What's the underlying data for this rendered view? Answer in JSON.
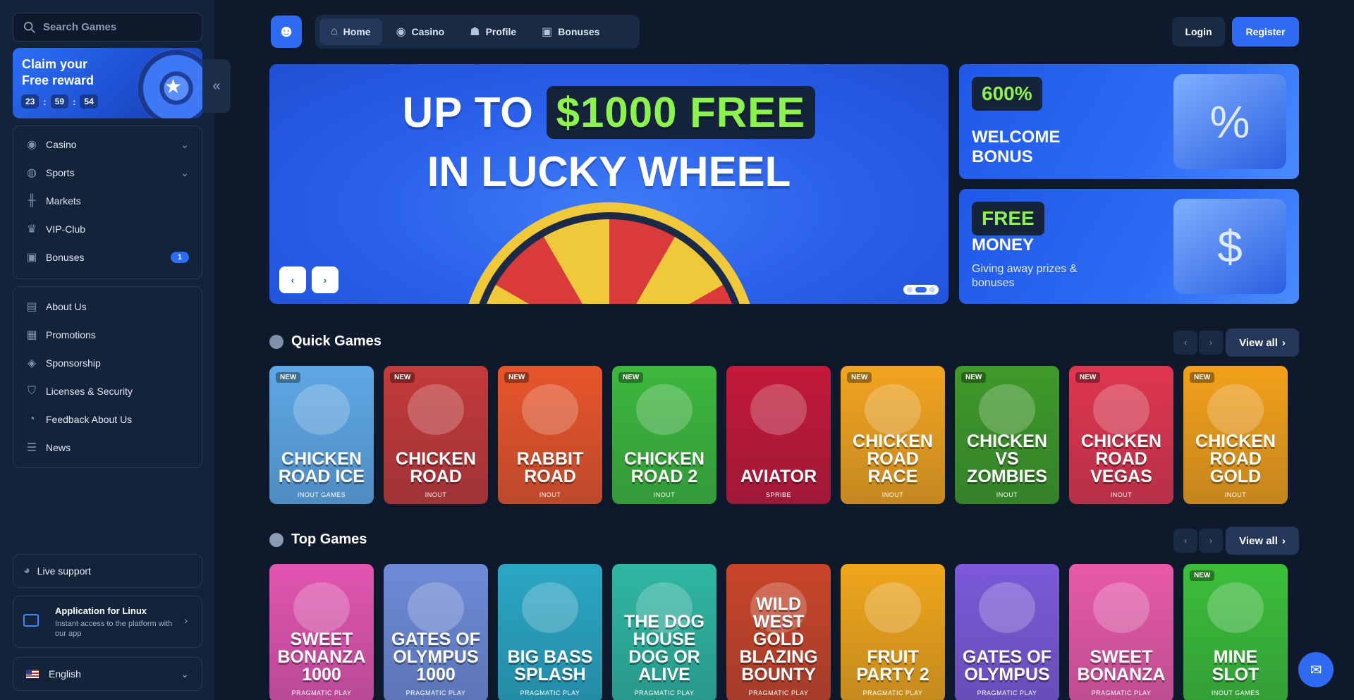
{
  "search": {
    "placeholder": "Search Games"
  },
  "reward": {
    "title": "Claim your Free reward",
    "timer": [
      "23",
      "59",
      "54"
    ]
  },
  "sidebar": {
    "group1": [
      {
        "label": "Casino",
        "icon": "casino-chip-icon",
        "chevron": true
      },
      {
        "label": "Sports",
        "icon": "globe-icon",
        "chevron": true
      },
      {
        "label": "Markets",
        "icon": "markets-chart-icon"
      },
      {
        "label": "VIP-Club",
        "icon": "crown-icon"
      },
      {
        "label": "Bonuses",
        "icon": "gift-icon",
        "badge": "1"
      }
    ],
    "group2": [
      {
        "label": "About Us",
        "icon": "book-icon"
      },
      {
        "label": "Promotions",
        "icon": "ticket-icon"
      },
      {
        "label": "Sponsorship",
        "icon": "sponsor-icon"
      },
      {
        "label": "Licenses & Security",
        "icon": "shield-icon"
      },
      {
        "label": "Feedback About Us",
        "icon": "feedback-icon"
      },
      {
        "label": "News",
        "icon": "news-icon"
      }
    ],
    "support": "Live support",
    "app": {
      "title": "Application for Linux",
      "subtitle": "Instant access to the platform with our app"
    },
    "language": "English"
  },
  "topnav": {
    "tabs": [
      {
        "label": "Home",
        "icon": "home-icon",
        "active": true
      },
      {
        "label": "Casino",
        "icon": "casino-chip-icon"
      },
      {
        "label": "Profile",
        "icon": "user-icon"
      },
      {
        "label": "Bonuses",
        "icon": "gift-icon"
      }
    ],
    "login": "Login",
    "register": "Register"
  },
  "hero": {
    "line1_a": "UP TO",
    "line1_highlight": "$1000 FREE",
    "line2": "IN LUCKY WHEEL",
    "slide_index": 2,
    "slide_count": 3
  },
  "promos": [
    {
      "tag": "600%",
      "heading": "WELCOME BONUS",
      "text": ""
    },
    {
      "tag": "FREE",
      "heading": "MONEY",
      "text": "Giving away prizes & bonuses"
    }
  ],
  "quick_games": {
    "title": "Quick Games",
    "view_all": "View all",
    "items": [
      {
        "name": "CHICKEN ROAD ICE",
        "provider": "INOUT GAMES",
        "new": true,
        "color": "#5fa8e6"
      },
      {
        "name": "CHICKEN ROAD",
        "provider": "INOUT",
        "new": true,
        "color": "#c43a3a"
      },
      {
        "name": "RABBIT ROAD",
        "provider": "INOUT",
        "new": true,
        "color": "#e8552b"
      },
      {
        "name": "CHICKEN ROAD 2",
        "provider": "INOUT",
        "new": true,
        "color": "#3db83d"
      },
      {
        "name": "AVIATOR",
        "provider": "SPRIBE",
        "new": false,
        "color": "#c4193a"
      },
      {
        "name": "CHICKEN ROAD RACE",
        "provider": "INOUT",
        "new": true,
        "color": "#f2a41f"
      },
      {
        "name": "CHICKEN VS ZOMBIES",
        "provider": "INOUT",
        "new": true,
        "color": "#3f9a2a"
      },
      {
        "name": "CHICKEN ROAD VEGAS",
        "provider": "INOUT",
        "new": true,
        "color": "#e0364f"
      },
      {
        "name": "CHICKEN ROAD GOLD",
        "provider": "INOUT",
        "new": true,
        "color": "#f2a01a"
      }
    ]
  },
  "top_games": {
    "title": "Top Games",
    "view_all": "View all",
    "items": [
      {
        "name": "SWEET BONANZA 1000",
        "provider": "PRAGMATIC PLAY",
        "new": false,
        "color": "#e255b0"
      },
      {
        "name": "GATES OF OLYMPUS 1000",
        "provider": "PRAGMATIC PLAY",
        "new": false,
        "color": "#6f8bd8"
      },
      {
        "name": "BIG BASS SPLASH",
        "provider": "PRAGMATIC PLAY",
        "new": false,
        "color": "#2aa7c4"
      },
      {
        "name": "THE DOG HOUSE DOG OR ALIVE",
        "provider": "PRAGMATIC PLAY",
        "new": false,
        "color": "#2fb7a2"
      },
      {
        "name": "WILD WEST GOLD BLAZING BOUNTY",
        "provider": "PRAGMATIC PLAY",
        "new": false,
        "color": "#c9452a"
      },
      {
        "name": "FRUIT PARTY 2",
        "provider": "PRAGMATIC PLAY",
        "new": false,
        "color": "#f0a61b"
      },
      {
        "name": "GATES OF OLYMPUS",
        "provider": "PRAGMATIC PLAY",
        "new": false,
        "color": "#7c5ad9"
      },
      {
        "name": "SWEET BONANZA",
        "provider": "PRAGMATIC PLAY",
        "new": false,
        "color": "#e85aa8"
      },
      {
        "name": "MINE SLOT",
        "provider": "INOUT GAMES",
        "new": true,
        "color": "#3cbf3a"
      }
    ]
  },
  "badge_new": "NEW"
}
